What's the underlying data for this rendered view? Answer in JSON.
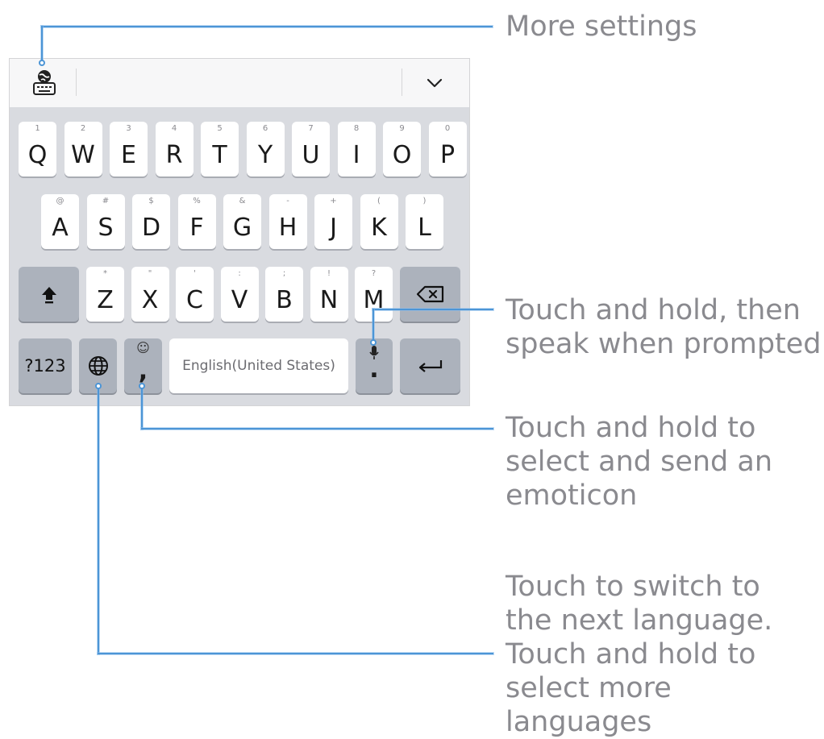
{
  "toolbar": {
    "settings_icon": "settings-globe-keyboard-icon",
    "collapse_icon": "chevron-down-icon"
  },
  "rows": {
    "row1": [
      {
        "main": "Q",
        "sub": "1"
      },
      {
        "main": "W",
        "sub": "2"
      },
      {
        "main": "E",
        "sub": "3"
      },
      {
        "main": "R",
        "sub": "4"
      },
      {
        "main": "T",
        "sub": "5"
      },
      {
        "main": "Y",
        "sub": "6"
      },
      {
        "main": "U",
        "sub": "7"
      },
      {
        "main": "I",
        "sub": "8"
      },
      {
        "main": "O",
        "sub": "9"
      },
      {
        "main": "P",
        "sub": "0"
      }
    ],
    "row2": [
      {
        "main": "A",
        "sub": "@"
      },
      {
        "main": "S",
        "sub": "#"
      },
      {
        "main": "D",
        "sub": "$"
      },
      {
        "main": "F",
        "sub": "%"
      },
      {
        "main": "G",
        "sub": "&"
      },
      {
        "main": "H",
        "sub": "-"
      },
      {
        "main": "J",
        "sub": "+"
      },
      {
        "main": "K",
        "sub": "("
      },
      {
        "main": "L",
        "sub": ")"
      }
    ],
    "row3": [
      {
        "main": "Z",
        "sub": "*"
      },
      {
        "main": "X",
        "sub": "\""
      },
      {
        "main": "C",
        "sub": "'"
      },
      {
        "main": "V",
        "sub": ":"
      },
      {
        "main": "B",
        "sub": ";"
      },
      {
        "main": "N",
        "sub": "!"
      },
      {
        "main": "M",
        "sub": "?"
      }
    ]
  },
  "bottom": {
    "symbols_label": "?123",
    "comma_main": ",",
    "comma_sub": "☺",
    "space_label": "English(United States)",
    "period_main": ".",
    "period_sub_icon": "microphone-icon"
  },
  "callouts": {
    "settings": "More settings",
    "voice": "Touch and hold, then\nspeak when prompted",
    "emoticon": "Touch and hold to\nselect and send an\nemoticon",
    "language": "Touch to switch to\nthe next language.\nTouch and hold to\nselect more\nlanguages"
  },
  "colors": {
    "callout_line": "#4c95d6",
    "callout_text": "#8a8a8f",
    "keyboard_bg": "#d9dbe0",
    "dark_key": "#acb2bc"
  }
}
